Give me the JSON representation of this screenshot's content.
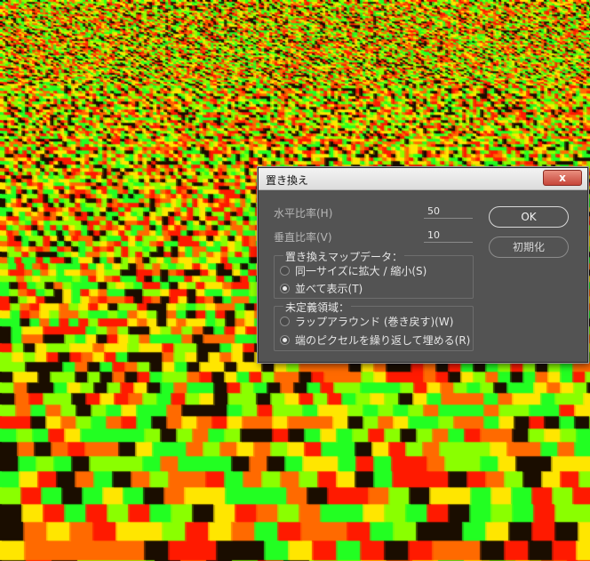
{
  "dialog": {
    "title": "置き換え",
    "close_label": "x",
    "fields": [
      {
        "label": "水平比率(H)",
        "value": "50"
      },
      {
        "label": "垂直比率(V)",
        "value": "10"
      }
    ],
    "map_group": {
      "title": "置き換えマップデータ：",
      "options": [
        {
          "label": "同一サイズに拡大 / 縮小(S)",
          "checked": false
        },
        {
          "label": "並べて表示(T)",
          "checked": true
        }
      ]
    },
    "undefined_group": {
      "title": "未定義領域：",
      "options": [
        {
          "label": "ラップアラウンド (巻き戻す)(W)",
          "checked": false
        },
        {
          "label": "端のピクセルを繰り返して埋める(R)",
          "checked": true
        }
      ]
    },
    "ok_label": "OK",
    "reset_label": "初期化"
  },
  "colors": {
    "dialog_bg": "#535353",
    "noise_red": "#ff1a00",
    "noise_green": "#22ff22",
    "noise_yellow": "#ffe600",
    "noise_dark": "#1a0d00"
  }
}
